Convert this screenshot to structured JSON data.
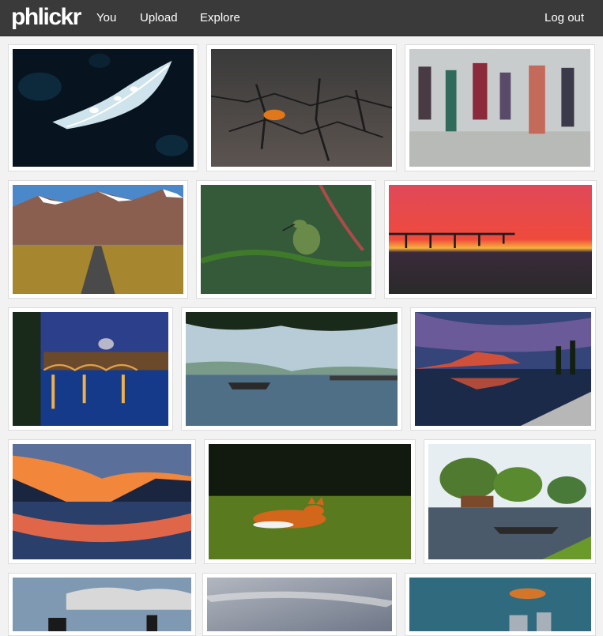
{
  "brand": {
    "logo": "phlickr"
  },
  "nav": {
    "you": "You",
    "upload": "Upload",
    "explore": "Explore",
    "logout": "Log out"
  },
  "photos": [
    {
      "subject": "water-drop-feather"
    },
    {
      "subject": "leaf-on-cracked-earth"
    },
    {
      "subject": "blurred-crowd"
    },
    {
      "subject": "mountain-road"
    },
    {
      "subject": "hummingbird"
    },
    {
      "subject": "pier-sunset"
    },
    {
      "subject": "river-bridge-night"
    },
    {
      "subject": "foggy-lake-boats"
    },
    {
      "subject": "mountain-reflection-dusk"
    },
    {
      "subject": "fjord-sunset"
    },
    {
      "subject": "resting-fox"
    },
    {
      "subject": "boat-pond-trees"
    },
    {
      "subject": "cloudy-sky-silhouettes"
    },
    {
      "subject": "stormy-sky"
    },
    {
      "subject": "moon-over-skyline"
    }
  ]
}
